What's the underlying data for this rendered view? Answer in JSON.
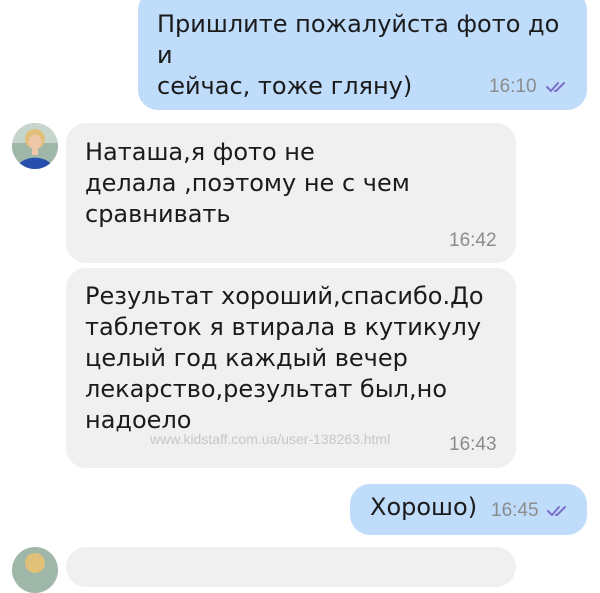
{
  "messages": [
    {
      "direction": "outgoing",
      "text": "Пришлите пожалуйста фото до и\nсейчас, тоже гляну)",
      "time": "16:10",
      "status_icon": "double-check-icon"
    },
    {
      "direction": "incoming",
      "text": "Наташа,я фото не\nделала ,поэтому не с чем\nсравнивать",
      "time": "16:42"
    },
    {
      "direction": "incoming",
      "text": "Результат хороший,спасибо.До\nтаблеток я втирала в кутикулу\nцелый год каждый вечер\nлекарство,результат был,но\nнадоело",
      "time": "16:43"
    },
    {
      "direction": "outgoing",
      "text": "Хорошо)",
      "time": "16:45",
      "status_icon": "double-check-icon"
    }
  ],
  "watermark": "www.kidstaff.com.ua/user-138263.html",
  "colors": {
    "outgoing_bubble": "#bfdcfa",
    "incoming_bubble": "#f0f0f0",
    "read_ticks": "#7c6fc9",
    "time_text": "#8c8c8c"
  }
}
